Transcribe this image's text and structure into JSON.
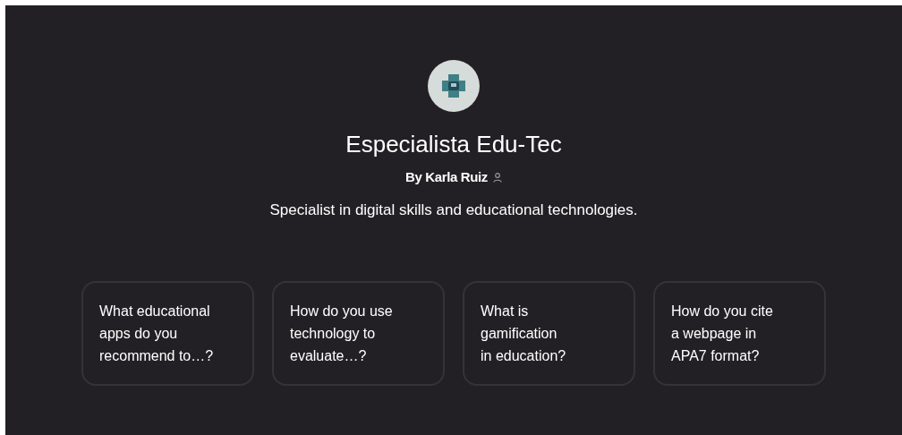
{
  "gpt": {
    "name": "Especialista Edu-Tec",
    "author": "By Karla Ruiz",
    "description": "Specialist in digital skills and educational technologies."
  },
  "prompts": [
    {
      "lines": [
        "What educational",
        "apps do you",
        "recommend to…?"
      ]
    },
    {
      "lines": [
        "How do you use",
        "technology to",
        "evaluate…?"
      ]
    },
    {
      "lines": [
        "What is",
        "gamification",
        "in education?"
      ]
    },
    {
      "lines": [
        "How do you cite",
        "a webpage in",
        "APA7 format?"
      ]
    }
  ]
}
